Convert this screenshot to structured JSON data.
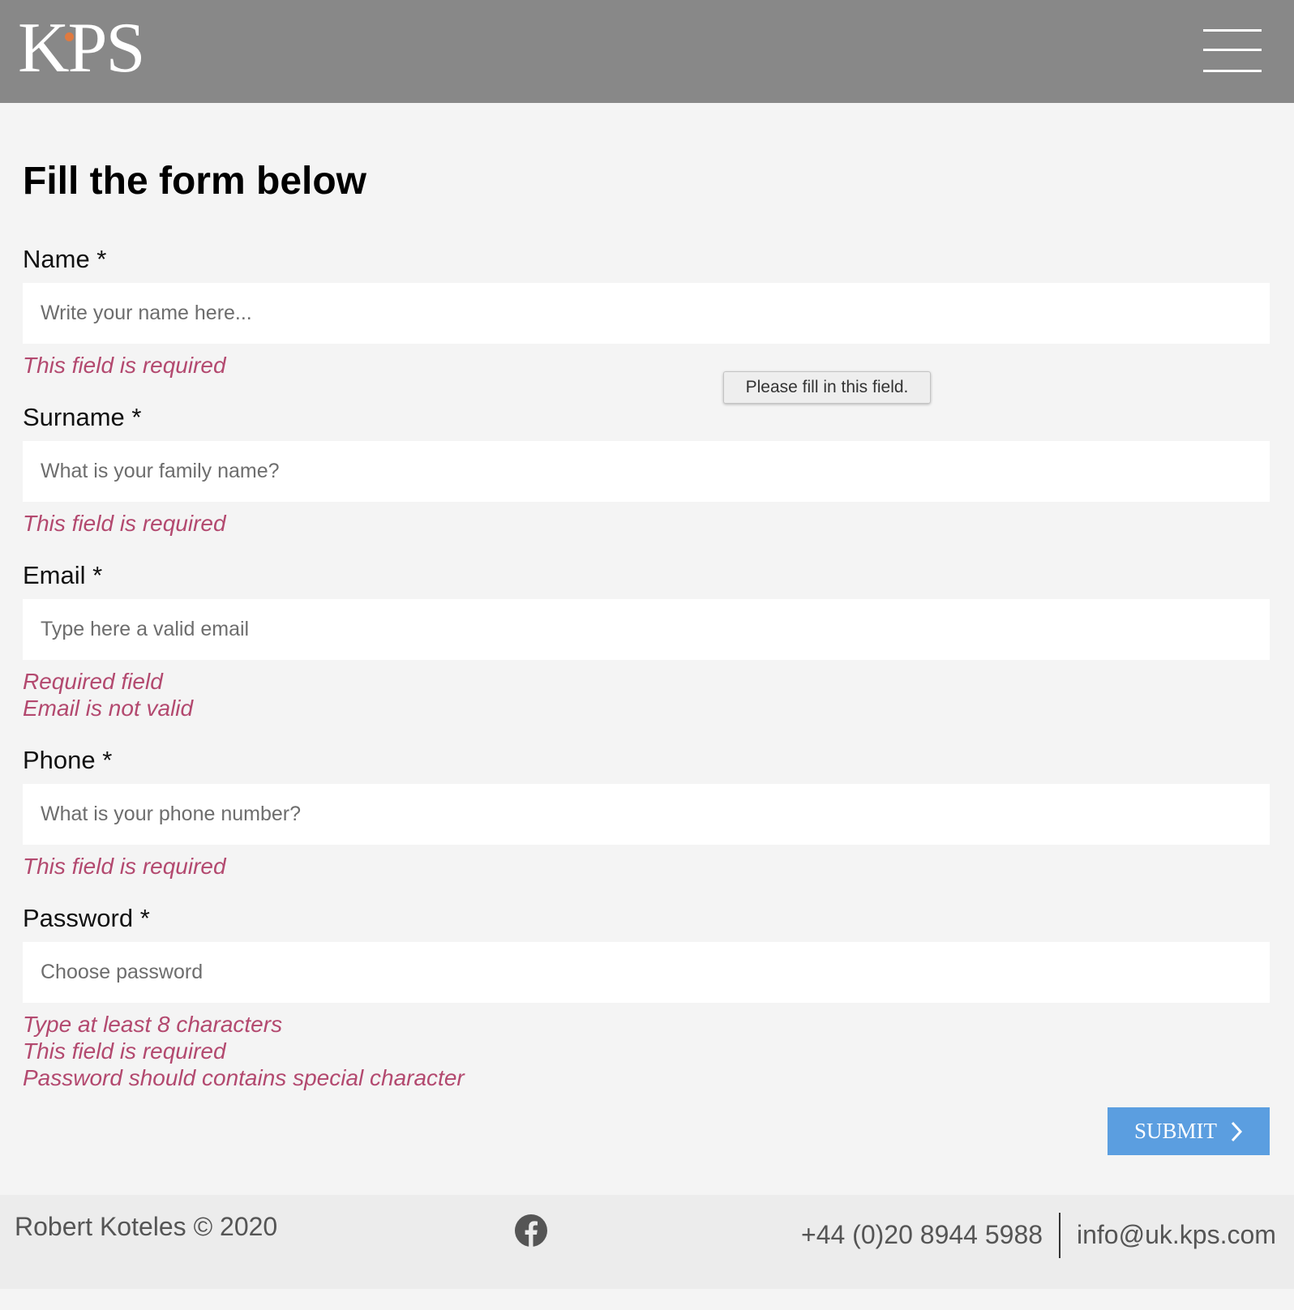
{
  "header": {
    "logo_text": "KPS",
    "accent_color": "#e07a3f",
    "menu_icon": "hamburger-menu-icon"
  },
  "form": {
    "title": "Fill the form below",
    "fields": [
      {
        "label": "Name *",
        "placeholder": "Write your name here...",
        "value": "",
        "errors": [
          "This field is required"
        ]
      },
      {
        "label": "Surname *",
        "placeholder": "What is your family name?",
        "value": "",
        "errors": [
          "This field is required"
        ]
      },
      {
        "label": "Email *",
        "placeholder": "Type here a valid email",
        "value": "",
        "errors": [
          "Required field",
          "Email is not valid"
        ]
      },
      {
        "label": "Phone *",
        "placeholder": "What is your phone number?",
        "value": "",
        "errors": [
          "This field is required"
        ]
      },
      {
        "label": "Password *",
        "placeholder": "Choose password",
        "value": "",
        "errors": [
          "Type at least 8 characters",
          "This field is required",
          "Password should contains special character"
        ]
      }
    ],
    "tooltip": "Please fill in this field.",
    "submit_label": "SUBMIT",
    "submit_icon": "chevron-right-icon",
    "error_color": "#b3496f",
    "button_color": "#5b9ee0"
  },
  "footer": {
    "copyright": "Robert Koteles © 2020",
    "social_icon": "facebook-icon",
    "phone": "+44 (0)20 8944 5988",
    "email": "info@uk.kps.com"
  }
}
